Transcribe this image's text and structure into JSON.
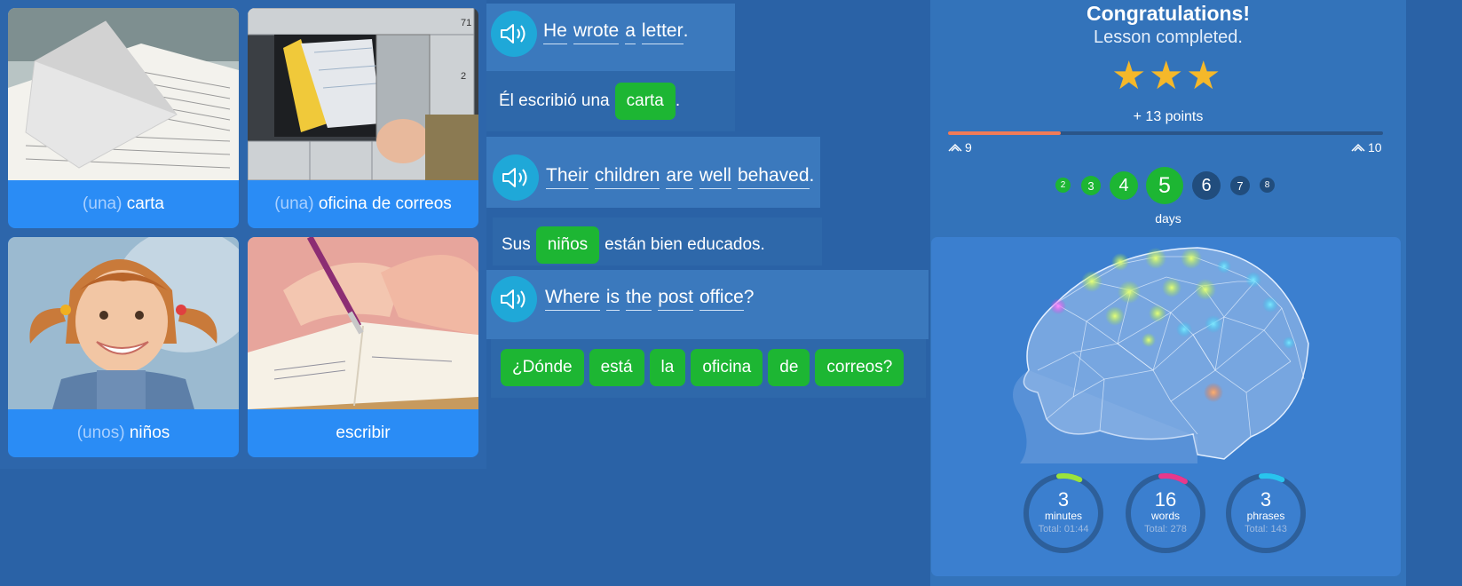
{
  "cards": [
    {
      "article": "(una)",
      "word": "carta",
      "image": "envelope-letter-image"
    },
    {
      "article": "(una)",
      "word": "oficina de correos",
      "image": "post-office-mailbox-image"
    },
    {
      "article": "(unos)",
      "word": "niños",
      "image": "smiling-girl-image"
    },
    {
      "article": "",
      "word": "escribir",
      "image": "hand-writing-image"
    }
  ],
  "sentences": [
    {
      "english": [
        "He",
        "wrote",
        "a",
        "letter"
      ],
      "english_end": ".",
      "spanish_before": "Él escribió una",
      "spanish_chip": "carta",
      "spanish_after": "."
    },
    {
      "english": [
        "Their",
        "children",
        "are",
        "well",
        "behaved"
      ],
      "english_end": ".",
      "spanish_before": "Sus",
      "spanish_chip": "niños",
      "spanish_after": "están bien educados."
    },
    {
      "english": [
        "Where",
        "is",
        "the",
        "post",
        "office"
      ],
      "english_end": "?",
      "spanish_chips": [
        "¿Dónde",
        "está",
        "la",
        "oficina",
        "de",
        "correos?"
      ]
    }
  ],
  "result": {
    "title": "Congratulations!",
    "subtitle": "Lesson completed.",
    "stars": 3,
    "points": "+ 13 points",
    "progress_fraction": 0.26,
    "level_current": "9",
    "level_next": "10",
    "days": [
      "2",
      "3",
      "4",
      "5",
      "6",
      "7",
      "8"
    ],
    "days_current": "5",
    "days_label": "days",
    "stats": [
      {
        "value": "3",
        "unit": "minutes",
        "total": "Total: 01:44",
        "color": "#9be33c"
      },
      {
        "value": "16",
        "unit": "words",
        "total": "Total: 278",
        "color": "#e8388c"
      },
      {
        "value": "3",
        "unit": "phrases",
        "total": "Total: 143",
        "color": "#28c4ee"
      }
    ]
  },
  "colors": {
    "background": "#2a62a6",
    "card_label": "#2a8cf5",
    "chip": "#1db633",
    "speaker": "#1fa8d8",
    "star": "#f5b82a",
    "progress": "#f07b58"
  }
}
